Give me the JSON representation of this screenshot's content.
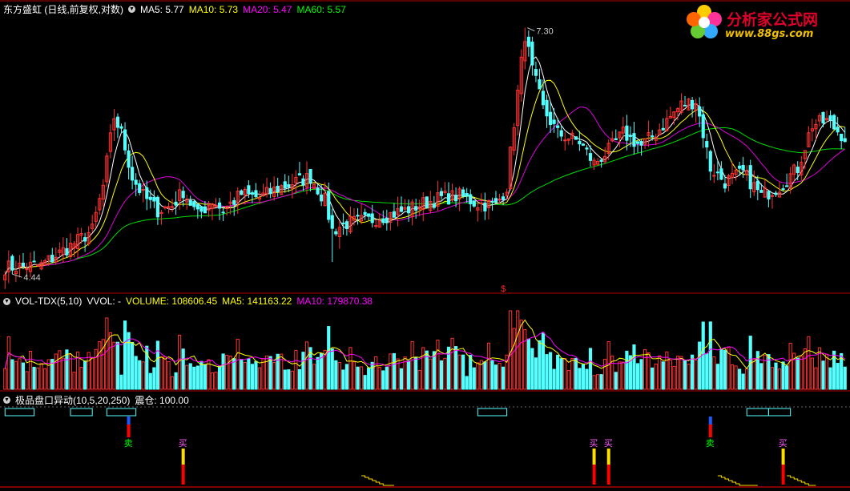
{
  "main_pane": {
    "title": "东方盛虹 (日线,前复权,对数)",
    "indicators": [
      {
        "label": "MA5: 5.77",
        "color": "#ffffff"
      },
      {
        "label": "MA10: 5.73",
        "color": "#ffff00"
      },
      {
        "label": "MA20: 5.47",
        "color": "#ff00ff"
      },
      {
        "label": "MA60: 5.57",
        "color": "#00ff00"
      }
    ],
    "high_label": "7.30",
    "low_label": "4.44",
    "marker": "$"
  },
  "volume_pane": {
    "title": "VOL-TDX(5,10)",
    "vol_label": "VVOL: -",
    "indicators": [
      {
        "label": "VOLUME: 108606.45",
        "color": "#ffff00"
      },
      {
        "label": "MA5: 141163.22",
        "color": "#ffff00"
      },
      {
        "label": "MA10: 179870.38",
        "color": "#ff00ff"
      }
    ]
  },
  "signal_pane": {
    "title": "极品盘口异动(10,5,20,250)",
    "indicators": [
      {
        "label": "震仓: 100.00",
        "color": "#ffffff"
      }
    ],
    "signals": [
      {
        "text": "卖",
        "color": "#00ff00",
        "index": 34
      },
      {
        "text": "买",
        "color": "#ff55ff",
        "index": 49
      },
      {
        "text": "买",
        "color": "#ff55ff",
        "index": 162
      },
      {
        "text": "买",
        "color": "#ff55ff",
        "index": 166
      },
      {
        "text": "卖",
        "color": "#00ff00",
        "index": 194
      },
      {
        "text": "买",
        "color": "#ff55ff",
        "index": 214
      }
    ]
  },
  "logo": {
    "name": "分析家公式网",
    "url": "www.88gs.com"
  },
  "chart_data": {
    "type": "candlestick",
    "title": "东方盛虹 (日线,前复权,对数)",
    "y_range": [
      4.3,
      7.5
    ],
    "y_scale": "log",
    "annotated_high": 7.3,
    "annotated_low": 4.44,
    "ma_last": {
      "MA5": 5.77,
      "MA10": 5.73,
      "MA20": 5.47,
      "MA60": 5.57
    },
    "volume_last": {
      "VOLUME": 108606.45,
      "MA5": 141163.22,
      "MA10": 179870.38
    },
    "anchors": [
      [
        0,
        4.5
      ],
      [
        10,
        4.52
      ],
      [
        18,
        4.7
      ],
      [
        24,
        4.85
      ],
      [
        27,
        5.3
      ],
      [
        30,
        6.1
      ],
      [
        32,
        5.9
      ],
      [
        35,
        5.4
      ],
      [
        38,
        5.2
      ],
      [
        42,
        5.05
      ],
      [
        46,
        5.1
      ],
      [
        49,
        5.25
      ],
      [
        53,
        5.0
      ],
      [
        57,
        5.15
      ],
      [
        60,
        5.05
      ],
      [
        65,
        5.22
      ],
      [
        70,
        5.18
      ],
      [
        75,
        5.28
      ],
      [
        80,
        5.35
      ],
      [
        84,
        5.4
      ],
      [
        88,
        5.15
      ],
      [
        90,
        4.85
      ],
      [
        94,
        4.92
      ],
      [
        100,
        4.95
      ],
      [
        110,
        5.05
      ],
      [
        115,
        5.12
      ],
      [
        120,
        5.18
      ],
      [
        125,
        5.2
      ],
      [
        130,
        5.12
      ],
      [
        135,
        5.1
      ],
      [
        138,
        5.3
      ],
      [
        141,
        6.4
      ],
      [
        143,
        7.2
      ],
      [
        145,
        6.7
      ],
      [
        148,
        6.2
      ],
      [
        152,
        5.9
      ],
      [
        158,
        5.8
      ],
      [
        162,
        5.55
      ],
      [
        166,
        5.7
      ],
      [
        170,
        5.9
      ],
      [
        175,
        5.75
      ],
      [
        180,
        5.95
      ],
      [
        186,
        6.25
      ],
      [
        190,
        6.3
      ],
      [
        194,
        5.5
      ],
      [
        198,
        5.35
      ],
      [
        203,
        5.45
      ],
      [
        208,
        5.2
      ],
      [
        213,
        5.3
      ],
      [
        218,
        5.5
      ],
      [
        222,
        6.0
      ],
      [
        226,
        6.05
      ],
      [
        231,
        5.85
      ]
    ],
    "count": 232
  }
}
